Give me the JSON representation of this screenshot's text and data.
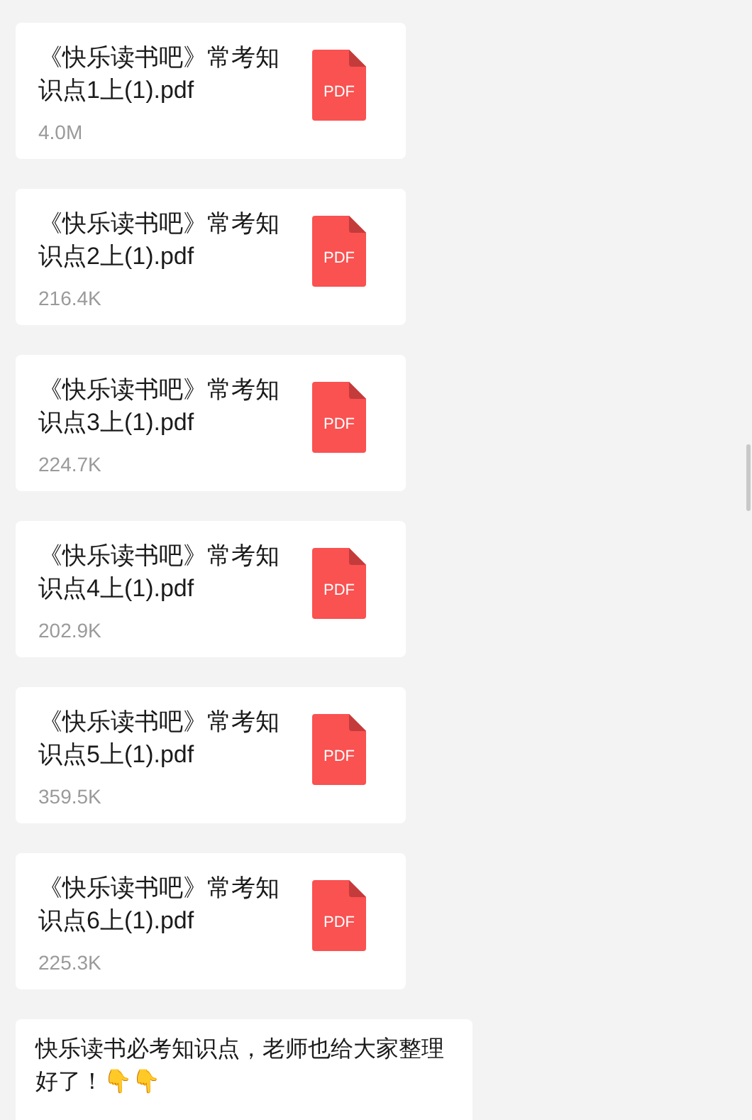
{
  "messages": [
    {
      "kind": "file",
      "name": "《快乐读书吧》常考知识点1上(1).pdf",
      "size": "4.0M",
      "file_type": "PDF"
    },
    {
      "kind": "file",
      "name": "《快乐读书吧》常考知识点2上(1).pdf",
      "size": "216.4K",
      "file_type": "PDF"
    },
    {
      "kind": "file",
      "name": "《快乐读书吧》常考知识点3上(1).pdf",
      "size": "224.7K",
      "file_type": "PDF"
    },
    {
      "kind": "file",
      "name": "《快乐读书吧》常考知识点4上(1).pdf",
      "size": "202.9K",
      "file_type": "PDF"
    },
    {
      "kind": "file",
      "name": "《快乐读书吧》常考知识点5上(1).pdf",
      "size": "359.5K",
      "file_type": "PDF"
    },
    {
      "kind": "file",
      "name": "《快乐读书吧》常考知识点6上(1).pdf",
      "size": "225.3K",
      "file_type": "PDF"
    },
    {
      "kind": "text",
      "text": "快乐读书必考知识点，老师也给大家整理好了！👇👇"
    }
  ]
}
